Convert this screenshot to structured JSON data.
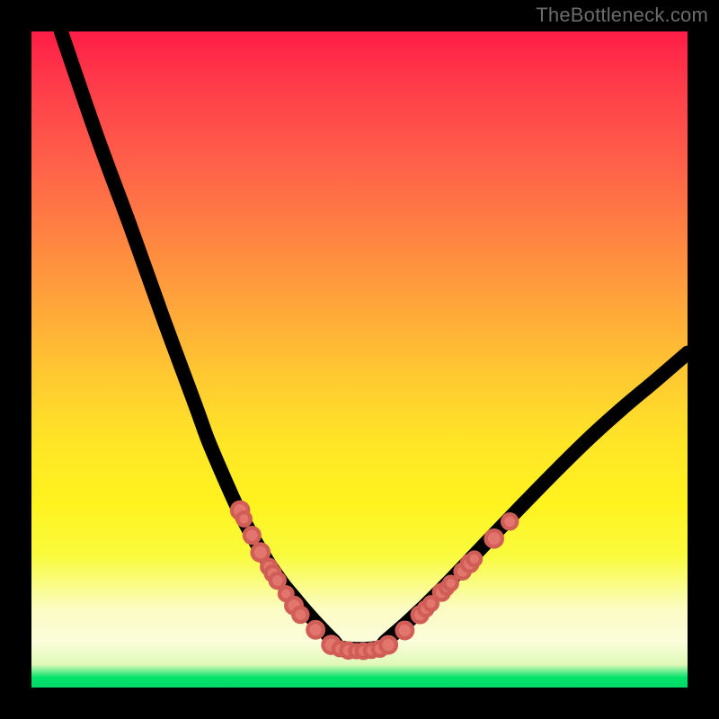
{
  "watermark": "TheBottleneck.com",
  "colors": {
    "frame_bg": "#000000",
    "dot_fill": "#e2766e",
    "dot_stroke": "#d05d56",
    "curve_stroke": "#000000"
  },
  "chart_data": {
    "type": "line",
    "title": "",
    "xlabel": "",
    "ylabel": "",
    "xlim": [
      0,
      100
    ],
    "ylim": [
      0,
      100
    ],
    "grid": false,
    "series": [
      {
        "name": "bottleneck-curve",
        "x": [
          4.5,
          10,
          15,
          20,
          25,
          27,
          30,
          32,
          34,
          36,
          37,
          38.5,
          40,
          41.5,
          43,
          44.5,
          46,
          47.5,
          52.5,
          54,
          55.5,
          57,
          58.5,
          60,
          61.5,
          63.5,
          66,
          70,
          75,
          80,
          85,
          90,
          95,
          100
        ],
        "values": [
          100,
          84,
          70.5,
          56.5,
          43,
          37.5,
          30.5,
          26.2,
          22.5,
          19.2,
          17.7,
          15.6,
          13.8,
          12,
          10.3,
          8.7,
          7.2,
          6,
          6,
          7.1,
          8.4,
          9.7,
          11.1,
          12.5,
          14,
          16,
          18.6,
          22.8,
          28,
          33.1,
          38,
          42.5,
          46.7,
          51
        ]
      }
    ],
    "annotations": {
      "left_markers": [
        {
          "x": 31.8,
          "y": 27.0,
          "r": 1.25
        },
        {
          "x": 32.4,
          "y": 25.7,
          "r": 1.0
        },
        {
          "x": 33.6,
          "y": 23.2,
          "r": 1.15
        },
        {
          "x": 34.9,
          "y": 20.6,
          "r": 1.25
        },
        {
          "x": 36.2,
          "y": 18.4,
          "r": 1.1
        },
        {
          "x": 36.8,
          "y": 17.4,
          "r": 1.1
        },
        {
          "x": 37.5,
          "y": 16.3,
          "r": 1.1
        },
        {
          "x": 38.8,
          "y": 14.3,
          "r": 1.0
        },
        {
          "x": 40.0,
          "y": 12.5,
          "r": 1.2
        },
        {
          "x": 41.0,
          "y": 11.1,
          "r": 1.1
        },
        {
          "x": 43.3,
          "y": 8.8,
          "r": 1.2
        }
      ],
      "bottom_markers": [
        {
          "x": 45.7,
          "y": 6.5,
          "r": 1.25
        },
        {
          "x": 47.0,
          "y": 5.9,
          "r": 1.0
        },
        {
          "x": 48.3,
          "y": 5.65,
          "r": 1.1
        },
        {
          "x": 49.5,
          "y": 5.55,
          "r": 0.95
        },
        {
          "x": 50.6,
          "y": 5.55,
          "r": 1.05
        },
        {
          "x": 51.8,
          "y": 5.65,
          "r": 1.0
        },
        {
          "x": 53.1,
          "y": 5.9,
          "r": 1.08
        },
        {
          "x": 54.4,
          "y": 6.5,
          "r": 1.2
        }
      ],
      "right_markers": [
        {
          "x": 56.9,
          "y": 8.7,
          "r": 1.2
        },
        {
          "x": 59.2,
          "y": 11.1,
          "r": 1.15
        },
        {
          "x": 60.1,
          "y": 12.0,
          "r": 1.05
        },
        {
          "x": 60.9,
          "y": 12.8,
          "r": 1.0
        },
        {
          "x": 62.5,
          "y": 14.5,
          "r": 1.15
        },
        {
          "x": 63.3,
          "y": 15.2,
          "r": 0.95
        },
        {
          "x": 63.9,
          "y": 15.9,
          "r": 1.0
        },
        {
          "x": 65.7,
          "y": 17.7,
          "r": 1.1
        },
        {
          "x": 66.8,
          "y": 18.9,
          "r": 1.2
        },
        {
          "x": 67.5,
          "y": 19.6,
          "r": 1.0
        },
        {
          "x": 70.5,
          "y": 22.7,
          "r": 1.25
        },
        {
          "x": 72.9,
          "y": 25.3,
          "r": 1.1
        }
      ]
    }
  }
}
